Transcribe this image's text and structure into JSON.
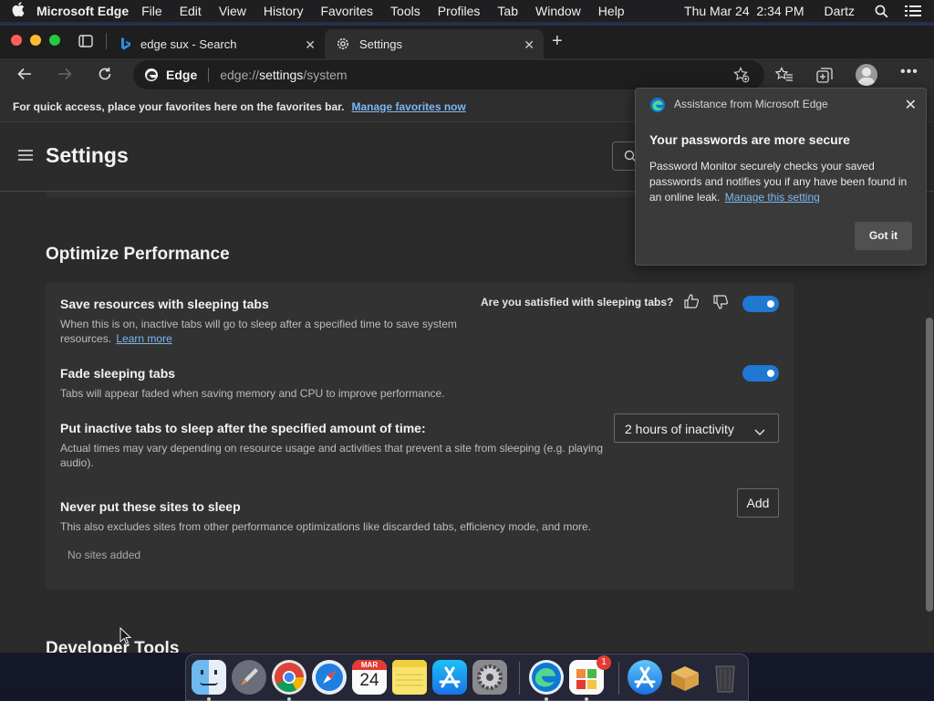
{
  "menubar": {
    "app_name": "Microsoft Edge",
    "items": [
      "File",
      "Edit",
      "View",
      "History",
      "Favorites",
      "Tools",
      "Profiles",
      "Tab",
      "Window",
      "Help"
    ],
    "datetime": "Thu Mar 24  2:34 PM",
    "user": "Dartz"
  },
  "tabs": [
    {
      "title": "edge sux - Search",
      "icon": "bing-icon"
    },
    {
      "title": "Settings",
      "icon": "gear-icon"
    }
  ],
  "address": {
    "site_label": "Edge",
    "url_prefix": "edge://",
    "url_bold": "settings",
    "url_suffix": "/system"
  },
  "favorites_bar": {
    "message": "For quick access, place your favorites here on the favorites bar.",
    "link": "Manage favorites now"
  },
  "settings": {
    "title": "Settings",
    "section_title": "Optimize Performance",
    "feedback_question": "Are you satisfied with sleeping tabs?",
    "rows": {
      "sleeping_tabs": {
        "title": "Save resources with sleeping tabs",
        "desc": "When this is on, inactive tabs will go to sleep after a specified time to save system resources.",
        "link": "Learn more",
        "on": true
      },
      "fade": {
        "title": "Fade sleeping tabs",
        "desc": "Tabs will appear faded when saving memory and CPU to improve performance.",
        "on": true
      },
      "inactive": {
        "title": "Put inactive tabs to sleep after the specified amount of time:",
        "desc": "Actual times may vary depending on resource usage and activities that prevent a site from sleeping (e.g. playing audio).",
        "selected": "2 hours of inactivity"
      },
      "never_sleep": {
        "title": "Never put these sites to sleep",
        "desc": "This also excludes sites from other performance optimizations like discarded tabs, efficiency mode, and more.",
        "add_label": "Add",
        "empty": "No sites added"
      }
    },
    "next_section": "Developer Tools"
  },
  "popup": {
    "source": "Assistance from Microsoft Edge",
    "title": "Your passwords are more secure",
    "body": "Password Monitor securely checks your saved passwords and notifies you if any have been found in an online leak.",
    "link": "Manage this setting",
    "button": "Got it"
  },
  "dock": {
    "calendar_month": "MAR",
    "calendar_day": "24",
    "badge": "1"
  },
  "colors": {
    "accent": "#1f78d1",
    "link": "#7cb7f0"
  }
}
